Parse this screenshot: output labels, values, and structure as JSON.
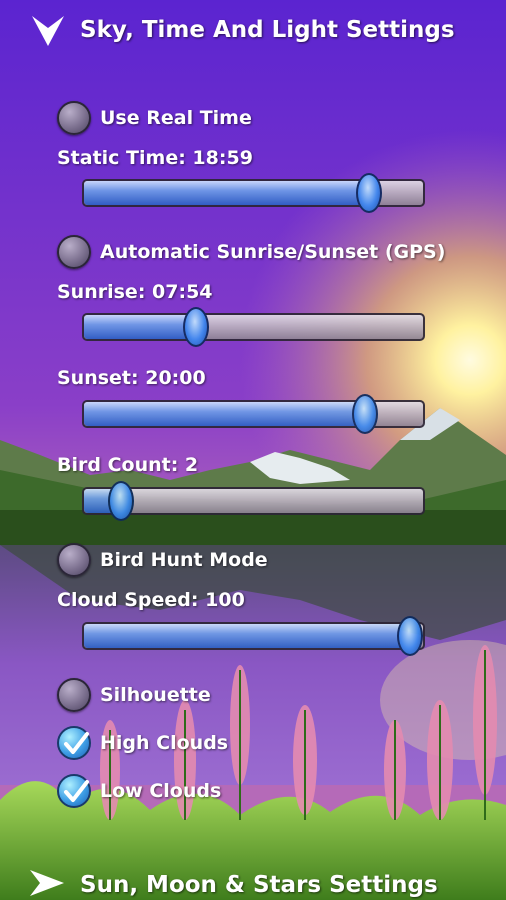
{
  "header": {
    "title": "Sky, Time And Light Settings"
  },
  "settings": {
    "use_real_time": {
      "label": "Use Real Time",
      "checked": false
    },
    "static_time": {
      "label": "Static Time: 18:59",
      "value": 0.84
    },
    "auto_sunrise": {
      "label": "Automatic Sunrise/Sunset (GPS)",
      "checked": false
    },
    "sunrise": {
      "label": "Sunrise: 07:54",
      "value": 0.33
    },
    "sunset": {
      "label": "Sunset: 20:00",
      "value": 0.83
    },
    "bird_count": {
      "label": "Bird Count: 2",
      "value": 0.11
    },
    "bird_hunt": {
      "label": "Bird Hunt Mode",
      "checked": false
    },
    "cloud_speed": {
      "label": "Cloud Speed: 100",
      "value": 1.0
    },
    "silhouette": {
      "label": "Silhouette",
      "checked": false
    },
    "high_clouds": {
      "label": "High Clouds",
      "checked": true
    },
    "low_clouds": {
      "label": "Low Clouds",
      "checked": true
    }
  },
  "footer": {
    "title": "Sun, Moon & Stars Settings"
  },
  "colors": {
    "sky_top": "#6a2fd6",
    "sun": "#fff3a8",
    "slider_fill": "#3d74d8"
  }
}
